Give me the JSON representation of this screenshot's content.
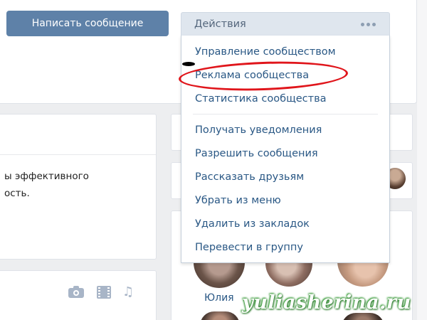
{
  "header": {
    "write_message_label": "Написать сообщение",
    "actions_label": "Действия"
  },
  "actions_menu": {
    "items": [
      "Управление сообществом",
      "Реклама сообщества",
      "Статистика сообщества",
      "Получать уведомления",
      "Разрешить сообщения",
      "Рассказать друзьям",
      "Убрать из меню",
      "Удалить из закладок",
      "Перевести в группу"
    ],
    "highlighted_item": "Реклама сообщества"
  },
  "post": {
    "line_1": "ы эффективного",
    "line_2": "ость."
  },
  "members": {
    "name_1": "Юлия"
  },
  "watermark": "yuliasherina.ru",
  "colors": {
    "accent_button": "#5e81a8",
    "menu_link": "#2a5885",
    "highlight_ellipse": "#e0151b",
    "watermark_glow": "#2e8b2e"
  }
}
